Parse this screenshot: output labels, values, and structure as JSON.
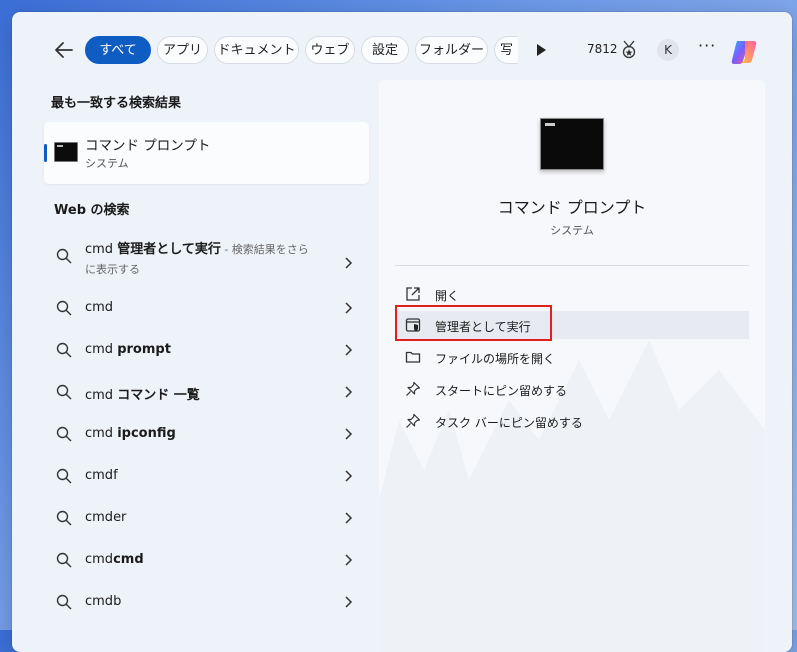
{
  "filters": {
    "back_label": "←",
    "tabs": [
      "すべて",
      "アプリ",
      "ドキュメント",
      "ウェブ",
      "設定",
      "フォルダー",
      "写"
    ],
    "points": "7812",
    "avatar_initial": "K",
    "more_label": "···"
  },
  "left": {
    "best_match_title": "最も一致する検索結果",
    "best_match": {
      "name": "コマンド プロンプト",
      "type": "システム"
    },
    "web_title": "Web の検索",
    "web_items": [
      {
        "prefix": "cmd ",
        "bold": "管理者として実行",
        "suffix": " - 検索結果をさらに表示する"
      },
      {
        "prefix": "cmd",
        "bold": "",
        "suffix": ""
      },
      {
        "prefix": "cmd ",
        "bold": "prompt",
        "suffix": ""
      },
      {
        "prefix": "cmd ",
        "bold": "コマンド 一覧",
        "suffix": ""
      },
      {
        "prefix": "cmd ",
        "bold": "ipconfig",
        "suffix": ""
      },
      {
        "prefix": "cmdf",
        "bold": "",
        "suffix": ""
      },
      {
        "prefix": "cmder",
        "bold": "",
        "suffix": ""
      },
      {
        "prefix": "cmd",
        "bold": "cmd",
        "suffix": ""
      },
      {
        "prefix": "cmdb",
        "bold": "",
        "suffix": ""
      }
    ]
  },
  "right": {
    "app_name": "コマンド プロンプト",
    "app_type": "システム",
    "actions": [
      {
        "label": "開く",
        "icon": "open-external-icon"
      },
      {
        "label": "管理者として実行",
        "icon": "shield-admin-icon"
      },
      {
        "label": "ファイルの場所を開く",
        "icon": "folder-icon"
      },
      {
        "label": "スタートにピン留めする",
        "icon": "pin-icon"
      },
      {
        "label": "タスク バーにピン留めする",
        "icon": "pin-icon"
      }
    ]
  },
  "colors": {
    "accent": "#0f5cc2",
    "highlight_box": "#e0201e"
  }
}
